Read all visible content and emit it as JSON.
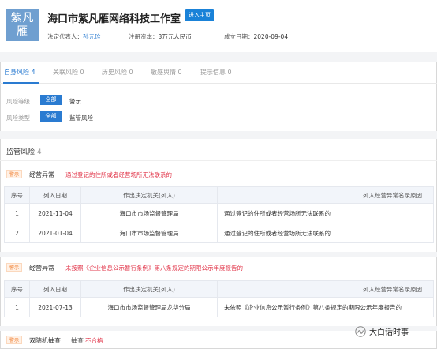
{
  "company": {
    "logo_line1": "紫凡",
    "logo_line2": "雁",
    "name": "海口市紫凡雁网络科技工作室",
    "home_button": "进入主页",
    "legal_rep_label": "法定代表人：",
    "legal_rep_value": "孙元珍",
    "capital_label": "注册资本：",
    "capital_value": "3万元人民币",
    "founded_label": "成立日期：",
    "founded_value": "2020-09-04"
  },
  "tabs": [
    {
      "label": "自身风险 4",
      "active": true
    },
    {
      "label": "关联风险 0",
      "active": false
    },
    {
      "label": "历史风险 0",
      "active": false
    },
    {
      "label": "敏感舆情 0",
      "active": false
    },
    {
      "label": "提示信息 0",
      "active": false
    }
  ],
  "filters": {
    "level": {
      "label": "风险等级",
      "chip": "全部",
      "value": "警示"
    },
    "type": {
      "label": "风险类型",
      "chip": "全部",
      "value": "监管风险"
    }
  },
  "section": {
    "title": "监管风险",
    "count": "4"
  },
  "risks": [
    {
      "badge": "警示",
      "type": "经营异常",
      "desc": "通过登记的住所或者经营场所无法联系的",
      "headers": [
        "序号",
        "列入日期",
        "作出决定机关(列入)",
        "列入经营异常名录原因"
      ],
      "rows": [
        [
          "1",
          "2021-11-04",
          "海口市市场监督管理局",
          "通过登记的住所或者经营场所无法联系的"
        ],
        [
          "2",
          "2021-01-04",
          "海口市市场监督管理局",
          "通过登记的住所或者经营场所无法联系的"
        ]
      ]
    },
    {
      "badge": "警示",
      "type": "经营异常",
      "desc": "未按照《企业信息公示暂行条例》第八条规定的期限公示年度报告的",
      "headers": [
        "序号",
        "列入日期",
        "作出决定机关(列入)",
        "列入经营异常名录原因"
      ],
      "rows": [
        [
          "1",
          "2021-07-13",
          "海口市市场监督管理局龙华分局",
          "未依照《企业信息公示暂行条例》第八条规定的期限公示年度报告的"
        ]
      ]
    },
    {
      "badge": "警示",
      "type": "双随机抽查",
      "desc_prefix": "抽查",
      "desc": "不合格"
    }
  ],
  "watermark": "大白话时事",
  "colors": {
    "accent": "#2a7bd1",
    "danger": "#e2374b",
    "warn": "#f07b2a"
  }
}
